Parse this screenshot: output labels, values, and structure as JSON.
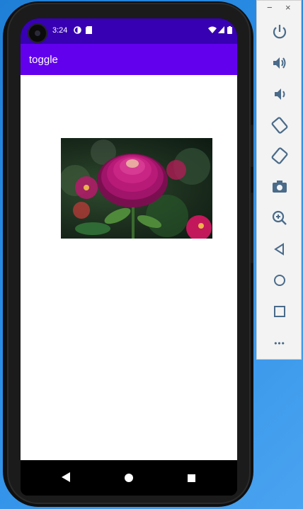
{
  "status_bar": {
    "time": "3:24"
  },
  "app_bar": {
    "title": "toggle"
  },
  "image": {
    "subject": "magenta zinnia flower"
  },
  "nav_bar": {
    "back": "back",
    "home": "home",
    "recents": "recents"
  },
  "emulator_panel": {
    "minimize": "−",
    "close": "×",
    "tools": [
      "power",
      "volume-up",
      "volume-down",
      "rotate-left",
      "rotate-right",
      "screenshot",
      "zoom",
      "back",
      "home",
      "overview",
      "more"
    ],
    "more_label": "•••"
  }
}
